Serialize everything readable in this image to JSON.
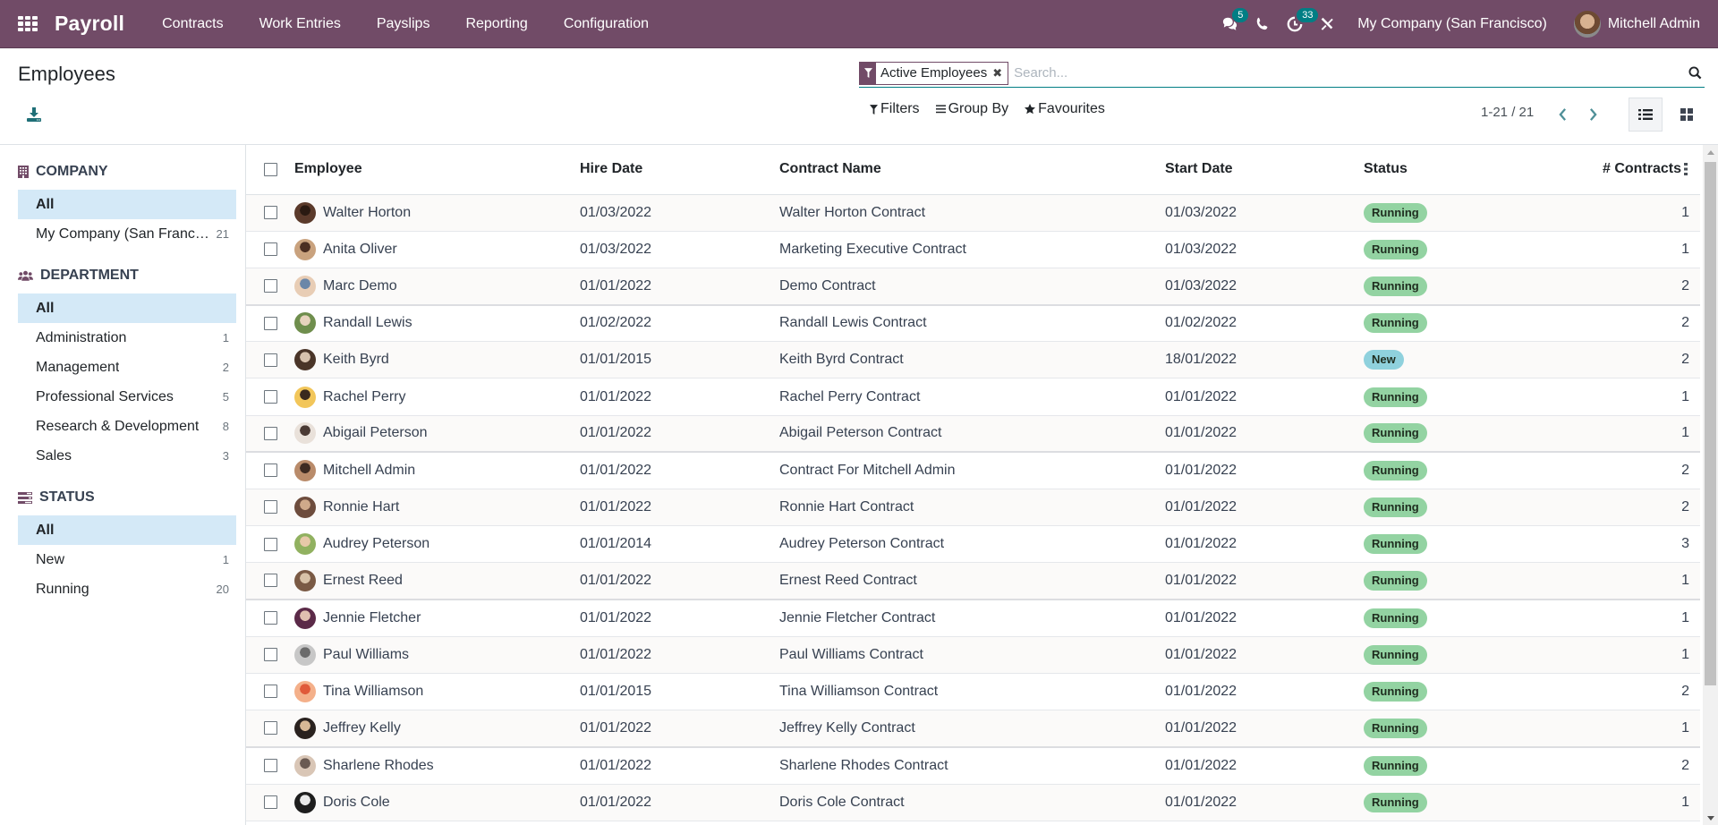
{
  "navbar": {
    "app_name": "Payroll",
    "menu": [
      "Contracts",
      "Work Entries",
      "Payslips",
      "Reporting",
      "Configuration"
    ],
    "messages_badge": "5",
    "activities_badge": "33",
    "company": "My Company (San Francisco)",
    "user": "Mitchell Admin",
    "brand_color": "#714B67",
    "badge_color": "#017E84"
  },
  "control_panel": {
    "title": "Employees",
    "search": {
      "facet_label": "Active Employees",
      "placeholder": "Search..."
    },
    "filters_label": "Filters",
    "group_by_label": "Group By",
    "favourites_label": "Favourites",
    "pager": "1-21 / 21"
  },
  "sidepanel": {
    "sections": [
      {
        "title": "COMPANY",
        "icon": "building-icon",
        "items": [
          {
            "label": "All",
            "count": "",
            "active": true
          },
          {
            "label": "My Company (San Francisco)",
            "count": "21",
            "active": false
          }
        ]
      },
      {
        "title": "DEPARTMENT",
        "icon": "users-icon",
        "items": [
          {
            "label": "All",
            "count": "",
            "active": true
          },
          {
            "label": "Administration",
            "count": "1",
            "active": false
          },
          {
            "label": "Management",
            "count": "2",
            "active": false
          },
          {
            "label": "Professional Services",
            "count": "5",
            "active": false
          },
          {
            "label": "Research & Development",
            "count": "8",
            "active": false
          },
          {
            "label": "Sales",
            "count": "3",
            "active": false
          }
        ]
      },
      {
        "title": "STATUS",
        "icon": "tasks-icon",
        "items": [
          {
            "label": "All",
            "count": "",
            "active": true
          },
          {
            "label": "New",
            "count": "1",
            "active": false
          },
          {
            "label": "Running",
            "count": "20",
            "active": false
          }
        ]
      }
    ]
  },
  "table": {
    "columns": [
      "Employee",
      "Hire Date",
      "Contract Name",
      "Start Date",
      "Status",
      "# Contracts"
    ],
    "status_colors": {
      "Running": "#93d3a2",
      "New": "#8fd1dd"
    },
    "rows": [
      {
        "employee": "Walter Horton",
        "hire_date": "01/03/2022",
        "contract": "Walter Horton Contract",
        "start_date": "01/03/2022",
        "status": "Running",
        "contracts": "1"
      },
      {
        "employee": "Anita Oliver",
        "hire_date": "01/03/2022",
        "contract": "Marketing Executive Contract",
        "start_date": "01/03/2022",
        "status": "Running",
        "contracts": "1"
      },
      {
        "employee": "Marc Demo",
        "hire_date": "01/01/2022",
        "contract": "Demo Contract",
        "start_date": "01/03/2022",
        "status": "Running",
        "contracts": "2"
      },
      {
        "employee": "Randall Lewis",
        "hire_date": "01/02/2022",
        "contract": "Randall Lewis Contract",
        "start_date": "01/02/2022",
        "status": "Running",
        "contracts": "2"
      },
      {
        "employee": "Keith Byrd",
        "hire_date": "01/01/2015",
        "contract": "Keith Byrd Contract",
        "start_date": "18/01/2022",
        "status": "New",
        "contracts": "2"
      },
      {
        "employee": "Rachel Perry",
        "hire_date": "01/01/2022",
        "contract": "Rachel Perry Contract",
        "start_date": "01/01/2022",
        "status": "Running",
        "contracts": "1"
      },
      {
        "employee": "Abigail Peterson",
        "hire_date": "01/01/2022",
        "contract": "Abigail Peterson Contract",
        "start_date": "01/01/2022",
        "status": "Running",
        "contracts": "1"
      },
      {
        "employee": "Mitchell Admin",
        "hire_date": "01/01/2022",
        "contract": "Contract For Mitchell Admin",
        "start_date": "01/01/2022",
        "status": "Running",
        "contracts": "2"
      },
      {
        "employee": "Ronnie Hart",
        "hire_date": "01/01/2022",
        "contract": "Ronnie Hart Contract",
        "start_date": "01/01/2022",
        "status": "Running",
        "contracts": "2"
      },
      {
        "employee": "Audrey Peterson",
        "hire_date": "01/01/2014",
        "contract": "Audrey Peterson Contract",
        "start_date": "01/01/2022",
        "status": "Running",
        "contracts": "3"
      },
      {
        "employee": "Ernest Reed",
        "hire_date": "01/01/2022",
        "contract": "Ernest Reed Contract",
        "start_date": "01/01/2022",
        "status": "Running",
        "contracts": "1"
      },
      {
        "employee": "Jennie Fletcher",
        "hire_date": "01/01/2022",
        "contract": "Jennie Fletcher Contract",
        "start_date": "01/01/2022",
        "status": "Running",
        "contracts": "1"
      },
      {
        "employee": "Paul Williams",
        "hire_date": "01/01/2022",
        "contract": "Paul Williams Contract",
        "start_date": "01/01/2022",
        "status": "Running",
        "contracts": "1"
      },
      {
        "employee": "Tina Williamson",
        "hire_date": "01/01/2015",
        "contract": "Tina Williamson Contract",
        "start_date": "01/01/2022",
        "status": "Running",
        "contracts": "2"
      },
      {
        "employee": "Jeffrey Kelly",
        "hire_date": "01/01/2022",
        "contract": "Jeffrey Kelly Contract",
        "start_date": "01/01/2022",
        "status": "Running",
        "contracts": "1"
      },
      {
        "employee": "Sharlene Rhodes",
        "hire_date": "01/01/2022",
        "contract": "Sharlene Rhodes Contract",
        "start_date": "01/01/2022",
        "status": "Running",
        "contracts": "2"
      },
      {
        "employee": "Doris Cole",
        "hire_date": "01/01/2022",
        "contract": "Doris Cole Contract",
        "start_date": "01/01/2022",
        "status": "Running",
        "contracts": "1"
      }
    ]
  }
}
